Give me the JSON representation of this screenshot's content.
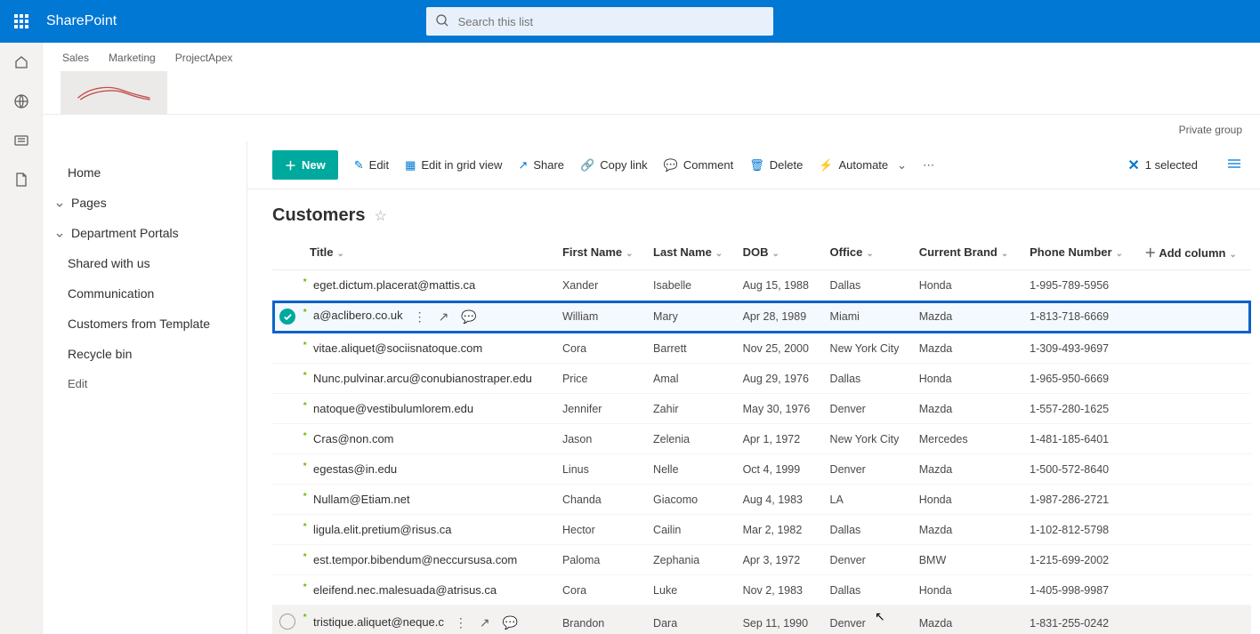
{
  "suite": {
    "app_name": "SharePoint",
    "search_placeholder": "Search this list"
  },
  "site": {
    "tabs": [
      "Sales",
      "Marketing",
      "ProjectApex"
    ],
    "private_label": "Private group"
  },
  "left_nav": {
    "home": "Home",
    "pages": "Pages",
    "dept": "Department Portals",
    "shared": "Shared with us",
    "communication": "Communication",
    "customers_tpl": "Customers from Template",
    "recycle": "Recycle bin",
    "edit": "Edit"
  },
  "command_bar": {
    "new": "New",
    "edit": "Edit",
    "grid": "Edit in grid view",
    "share": "Share",
    "copylink": "Copy link",
    "comment": "Comment",
    "delete": "Delete",
    "automate": "Automate",
    "selected_count": "1 selected"
  },
  "list": {
    "title": "Customers",
    "columns": {
      "title": "Title",
      "first_name": "First Name",
      "last_name": "Last Name",
      "dob": "DOB",
      "office": "Office",
      "brand": "Current Brand",
      "phone": "Phone Number",
      "add": "Add column"
    },
    "rows": [
      {
        "title": "eget.dictum.placerat@mattis.ca",
        "first": "Xander",
        "last": "Isabelle",
        "dob": "Aug 15, 1988",
        "office": "Dallas",
        "brand": "Honda",
        "phone": "1-995-789-5956",
        "state": ""
      },
      {
        "title": "a@aclibero.co.uk",
        "first": "William",
        "last": "Mary",
        "dob": "Apr 28, 1989",
        "office": "Miami",
        "brand": "Mazda",
        "phone": "1-813-718-6669",
        "state": "selected"
      },
      {
        "title": "vitae.aliquet@sociisnatoque.com",
        "first": "Cora",
        "last": "Barrett",
        "dob": "Nov 25, 2000",
        "office": "New York City",
        "brand": "Mazda",
        "phone": "1-309-493-9697",
        "state": ""
      },
      {
        "title": "Nunc.pulvinar.arcu@conubianostraper.edu",
        "first": "Price",
        "last": "Amal",
        "dob": "Aug 29, 1976",
        "office": "Dallas",
        "brand": "Honda",
        "phone": "1-965-950-6669",
        "state": ""
      },
      {
        "title": "natoque@vestibulumlorem.edu",
        "first": "Jennifer",
        "last": "Zahir",
        "dob": "May 30, 1976",
        "office": "Denver",
        "brand": "Mazda",
        "phone": "1-557-280-1625",
        "state": ""
      },
      {
        "title": "Cras@non.com",
        "first": "Jason",
        "last": "Zelenia",
        "dob": "Apr 1, 1972",
        "office": "New York City",
        "brand": "Mercedes",
        "phone": "1-481-185-6401",
        "state": ""
      },
      {
        "title": "egestas@in.edu",
        "first": "Linus",
        "last": "Nelle",
        "dob": "Oct 4, 1999",
        "office": "Denver",
        "brand": "Mazda",
        "phone": "1-500-572-8640",
        "state": ""
      },
      {
        "title": "Nullam@Etiam.net",
        "first": "Chanda",
        "last": "Giacomo",
        "dob": "Aug 4, 1983",
        "office": "LA",
        "brand": "Honda",
        "phone": "1-987-286-2721",
        "state": ""
      },
      {
        "title": "ligula.elit.pretium@risus.ca",
        "first": "Hector",
        "last": "Cailin",
        "dob": "Mar 2, 1982",
        "office": "Dallas",
        "brand": "Mazda",
        "phone": "1-102-812-5798",
        "state": ""
      },
      {
        "title": "est.tempor.bibendum@neccursusa.com",
        "first": "Paloma",
        "last": "Zephania",
        "dob": "Apr 3, 1972",
        "office": "Denver",
        "brand": "BMW",
        "phone": "1-215-699-2002",
        "state": ""
      },
      {
        "title": "eleifend.nec.malesuada@atrisus.ca",
        "first": "Cora",
        "last": "Luke",
        "dob": "Nov 2, 1983",
        "office": "Dallas",
        "brand": "Honda",
        "phone": "1-405-998-9987",
        "state": ""
      },
      {
        "title": "tristique.aliquet@neque.c",
        "first": "Brandon",
        "last": "Dara",
        "dob": "Sep 11, 1990",
        "office": "Denver",
        "brand": "Mazda",
        "phone": "1-831-255-0242",
        "state": "hovered"
      }
    ]
  }
}
